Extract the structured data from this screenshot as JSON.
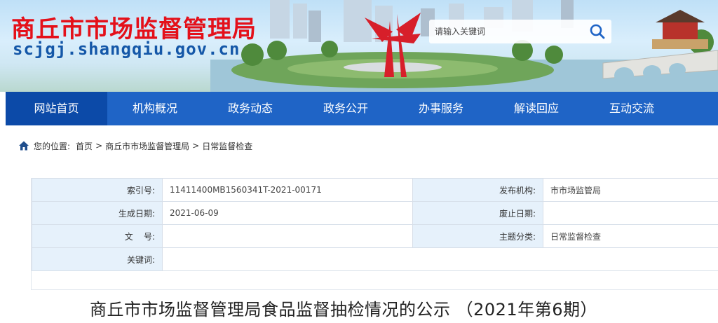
{
  "header": {
    "site_title": "商丘市市场监督管理局",
    "site_domain": "scjgj.shangqiu.gov.cn",
    "search": {
      "placeholder": "请输入关键词",
      "icon": "search-icon"
    }
  },
  "nav": {
    "items": [
      {
        "label": "网站首页",
        "active": true
      },
      {
        "label": "机构概况"
      },
      {
        "label": "政务动态"
      },
      {
        "label": "政务公开"
      },
      {
        "label": "办事服务"
      },
      {
        "label": "解读回应"
      },
      {
        "label": "互动交流"
      }
    ]
  },
  "breadcrumb": {
    "icon": "home-icon",
    "prefix": "您的位置:",
    "items": [
      "首页",
      "商丘市市场监督管理局",
      "日常监督检查"
    ],
    "separator": ">"
  },
  "info": {
    "index_label": "索引号:",
    "index_value": "11411400MB1560341T-2021-00171",
    "publisher_label": "发布机构:",
    "publisher_value": "市市场监管局",
    "created_label": "生成日期:",
    "created_value": "2021-06-09",
    "abolish_label": "废止日期:",
    "abolish_value": "",
    "docno_label": "文    号:",
    "docno_value": "",
    "topic_label": "主题分类:",
    "topic_value": "日常监督检查",
    "keywords_label": "关键词:",
    "keywords_value": ""
  },
  "article": {
    "title": "商丘市市场监督管理局食品监督抽检情况的公示 （2021年第6期）"
  },
  "colors": {
    "brand_red": "#e4101a",
    "domain_blue": "#1457a8",
    "nav_blue": "#1f64c6",
    "nav_active": "#0c4aa8",
    "label_bg": "#e6f1fb"
  }
}
